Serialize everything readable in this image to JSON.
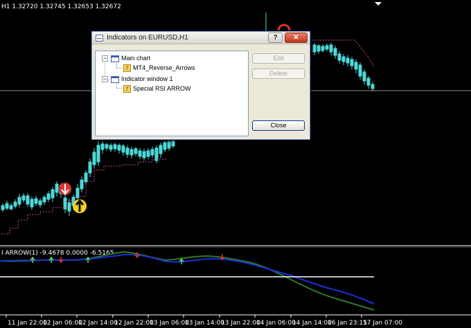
{
  "chart": {
    "main_header": "H1  1.32720 1.32745 1.32653 1.32672",
    "indicator_header": "I ARROW(1) -9.4678 0.0000 -6.5165",
    "time_axis": [
      "11 Jan 22:00",
      "12 Jan 06:00",
      "12 Jan 14:00",
      "12 Jan 22:00",
      "13 Jan 06:00",
      "13 Jan 14:00",
      "13 Jan 22:00",
      "14 Jan 06:00",
      "14 Jan 14:00",
      "16 Jan 23:15",
      "17 Jan 07:00"
    ],
    "colors": {
      "background": "#000000",
      "candle": "#4ed8d8",
      "ma_dotted": "#c8509a",
      "rsi_fast": "#1b2fd6",
      "rsi_slow": "#2d7b2a",
      "signal_up": "#66cc66",
      "signal_down": "#d9342b",
      "level_line": "#ffffff"
    }
  },
  "dialog": {
    "title": "Indicators on EURUSD,H1",
    "help_label": "?",
    "close_x": "✕",
    "tree": {
      "main_chart": "Main chart",
      "main_indicator": "MT4_Reverse_Arrows",
      "indicator_window": "Indicator window 1",
      "window_indicator": "Special RSI ARROW"
    },
    "buttons": {
      "edit": "Edit",
      "delete": "Delete",
      "close": "Close"
    }
  }
}
